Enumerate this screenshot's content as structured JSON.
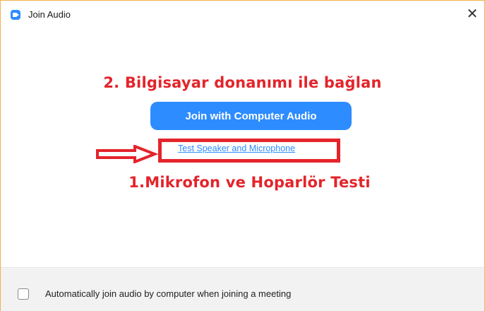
{
  "window": {
    "title": "Join Audio",
    "close_glyph": "✕",
    "app_icon": "zoom-app-icon"
  },
  "main": {
    "annotation_step2": "2. Bilgisayar donanımı ile bağlan",
    "join_button_label": "Join with Computer Audio",
    "test_link_label": "Test Speaker and Microphone",
    "annotation_step1": "1.Mikrofon ve Hoparlör Testi"
  },
  "footer": {
    "checkbox_label": "Automatically join audio by computer when joining a meeting",
    "checkbox_checked": false
  },
  "colors": {
    "accent": "#2d8cff",
    "annotation_red": "#e3242b",
    "window_border": "#f0b24a"
  }
}
